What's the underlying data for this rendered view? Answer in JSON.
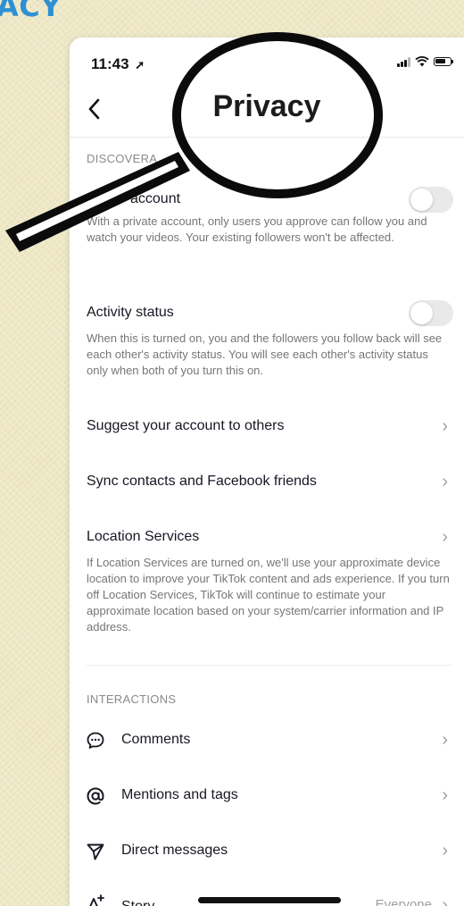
{
  "poster": {
    "title": "ACY"
  },
  "status_bar": {
    "time": "11:43",
    "location_arrow": "location-arrow-icon"
  },
  "nav": {
    "title": "Privacy",
    "back": "chevron-left-icon"
  },
  "sections": {
    "discoverability_label": "DISCOVERA",
    "interactions_label": "INTERACTIONS"
  },
  "private_account": {
    "title": "account",
    "description": "With a private account, only users you approve can follow you and watch your videos. Your existing followers won't be affected.",
    "enabled": false
  },
  "activity_status": {
    "title": "Activity status",
    "description": "When this is turned on, you and the followers you follow back will see each other's activity status. You will see each other's activity status only when both of you turn this on.",
    "enabled": false
  },
  "suggest_account": {
    "title": "Suggest your account to others"
  },
  "sync_contacts": {
    "title": "Sync contacts and Facebook friends"
  },
  "location_services": {
    "title": "Location Services",
    "description": "If Location Services are turned on, we'll use your approximate device location to improve your TikTok content and ads experience. If you turn off Location Services, TikTok will continue to estimate your approximate location based on your system/carrier information and IP address."
  },
  "interactions": {
    "comments": "Comments",
    "mentions": "Mentions and tags",
    "direct_messages": "Direct messages",
    "story": "Story",
    "story_value": "Everyone"
  },
  "colors": {
    "accent_title": "#2f8fd4",
    "background": "#eee8c6",
    "toggle_off": "#e9e9ea"
  }
}
